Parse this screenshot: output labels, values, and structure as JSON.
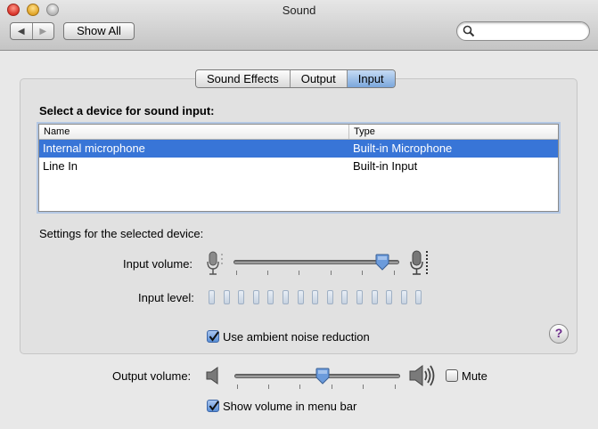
{
  "window": {
    "title": "Sound"
  },
  "toolbar": {
    "back": "◀",
    "forward": "▶",
    "show_all": "Show All",
    "search_placeholder": ""
  },
  "tabs": [
    {
      "label": "Sound Effects",
      "active": false
    },
    {
      "label": "Output",
      "active": false
    },
    {
      "label": "Input",
      "active": true
    }
  ],
  "input": {
    "select_heading": "Select a device for sound input:",
    "columns": [
      "Name",
      "Type"
    ],
    "devices": [
      {
        "name": "Internal microphone",
        "type": "Built-in Microphone",
        "selected": true
      },
      {
        "name": "Line In",
        "type": "Built-in Input",
        "selected": false
      }
    ],
    "settings_heading": "Settings for the selected device:",
    "input_volume_label": "Input volume:",
    "input_volume_fraction": 0.9,
    "input_level_label": "Input level:",
    "input_level_segments": 15,
    "input_level_lit": 0,
    "ambient_noise_label": "Use ambient noise reduction",
    "ambient_noise_checked": true,
    "help": "?"
  },
  "output": {
    "volume_label": "Output volume:",
    "volume_fraction": 0.53,
    "mute_label": "Mute",
    "mute_checked": false,
    "menu_bar_label": "Show volume in menu bar",
    "menu_bar_checked": true
  },
  "colors": {
    "selection": "#3875d7",
    "active_tab": "#7ba7dc",
    "level_segment": "#c6d2e0"
  },
  "icons": [
    "search-icon",
    "microphone-low-icon",
    "microphone-high-icon",
    "speaker-low-icon",
    "speaker-high-icon",
    "checkmark-icon",
    "help-icon"
  ]
}
